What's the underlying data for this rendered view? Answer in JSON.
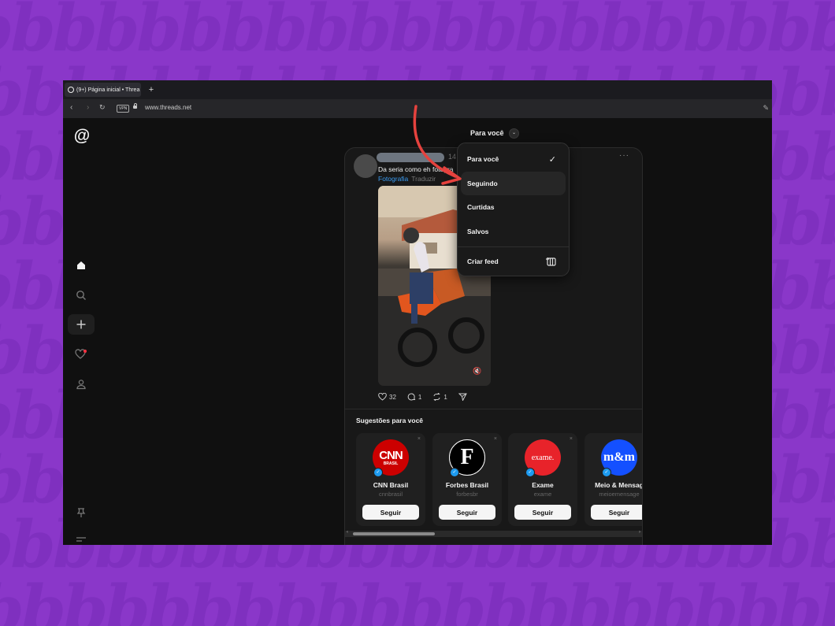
{
  "browser": {
    "tab_title": "(9+) Página inicial • Threa",
    "new_tab_icon": "+",
    "url": "www.threads.net",
    "vpn_label": "VPN"
  },
  "sidebar": {
    "logo": "@",
    "icons": [
      "home-icon",
      "search-icon",
      "create-icon",
      "activity-icon",
      "profile-icon",
      "pin-icon",
      "menu-icon"
    ]
  },
  "feed": {
    "heading": "Para você",
    "dropdown_items": [
      {
        "label": "Para você",
        "selected": true
      },
      {
        "label": "Seguindo",
        "selected": false
      },
      {
        "label": "Curtidas",
        "selected": false
      },
      {
        "label": "Salvos",
        "selected": false
      },
      {
        "label": "Criar feed",
        "selected": false
      }
    ]
  },
  "post": {
    "time": "14",
    "caption": "Da seria como eh fotogra",
    "tag": "Fotografia",
    "translate": "Traduzir",
    "likes": "32",
    "replies": "1",
    "reposts": "1"
  },
  "suggestions": {
    "title": "Sugestões para você",
    "follow_label": "Seguir",
    "accounts": [
      {
        "name": "CNN Brasil",
        "handle": "cnnbrasil",
        "logo_text": "CNN",
        "logo_sub": "BRASIL",
        "color": "#cc0000"
      },
      {
        "name": "Forbes Brasil",
        "handle": "forbesbr",
        "logo_text": "F",
        "logo_sub": "",
        "color": "#000000"
      },
      {
        "name": "Exame",
        "handle": "exame",
        "logo_text": "exame.",
        "logo_sub": "",
        "color": "#e8232a"
      },
      {
        "name": "Meio & Mensag",
        "handle": "meioemensage",
        "logo_text": "m&m",
        "logo_sub": "",
        "color": "#1450ff"
      }
    ]
  },
  "colors": {
    "background": "#8a37c9",
    "annotation_arrow": "#e5423e",
    "link": "#3b9bf0"
  }
}
